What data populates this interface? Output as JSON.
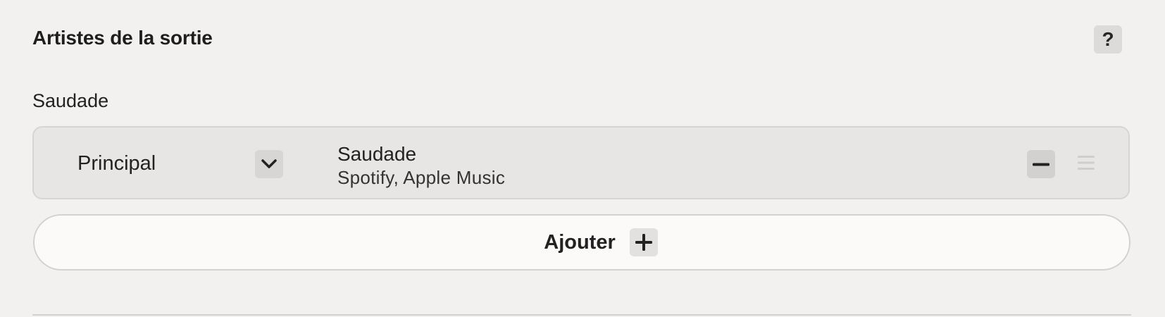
{
  "section": {
    "title": "Artistes de la sortie",
    "help_label": "?"
  },
  "group": {
    "label": "Saudade"
  },
  "artists": [
    {
      "role": "Principal",
      "name": "Saudade",
      "platforms": "Spotify, Apple Music"
    }
  ],
  "actions": {
    "add_label": "Ajouter"
  },
  "icons": {
    "role_dropdown": "chevron-down-icon",
    "remove": "minus-icon",
    "drag": "drag-handle-icon",
    "add": "plus-icon",
    "help": "question-mark-icon"
  },
  "colors": {
    "background": "#f2f1ef",
    "row_background": "#e7e6e4",
    "button_background": "#fbfaf9",
    "icon_button": "#dcdbd9",
    "text": "#1f1f1f"
  }
}
